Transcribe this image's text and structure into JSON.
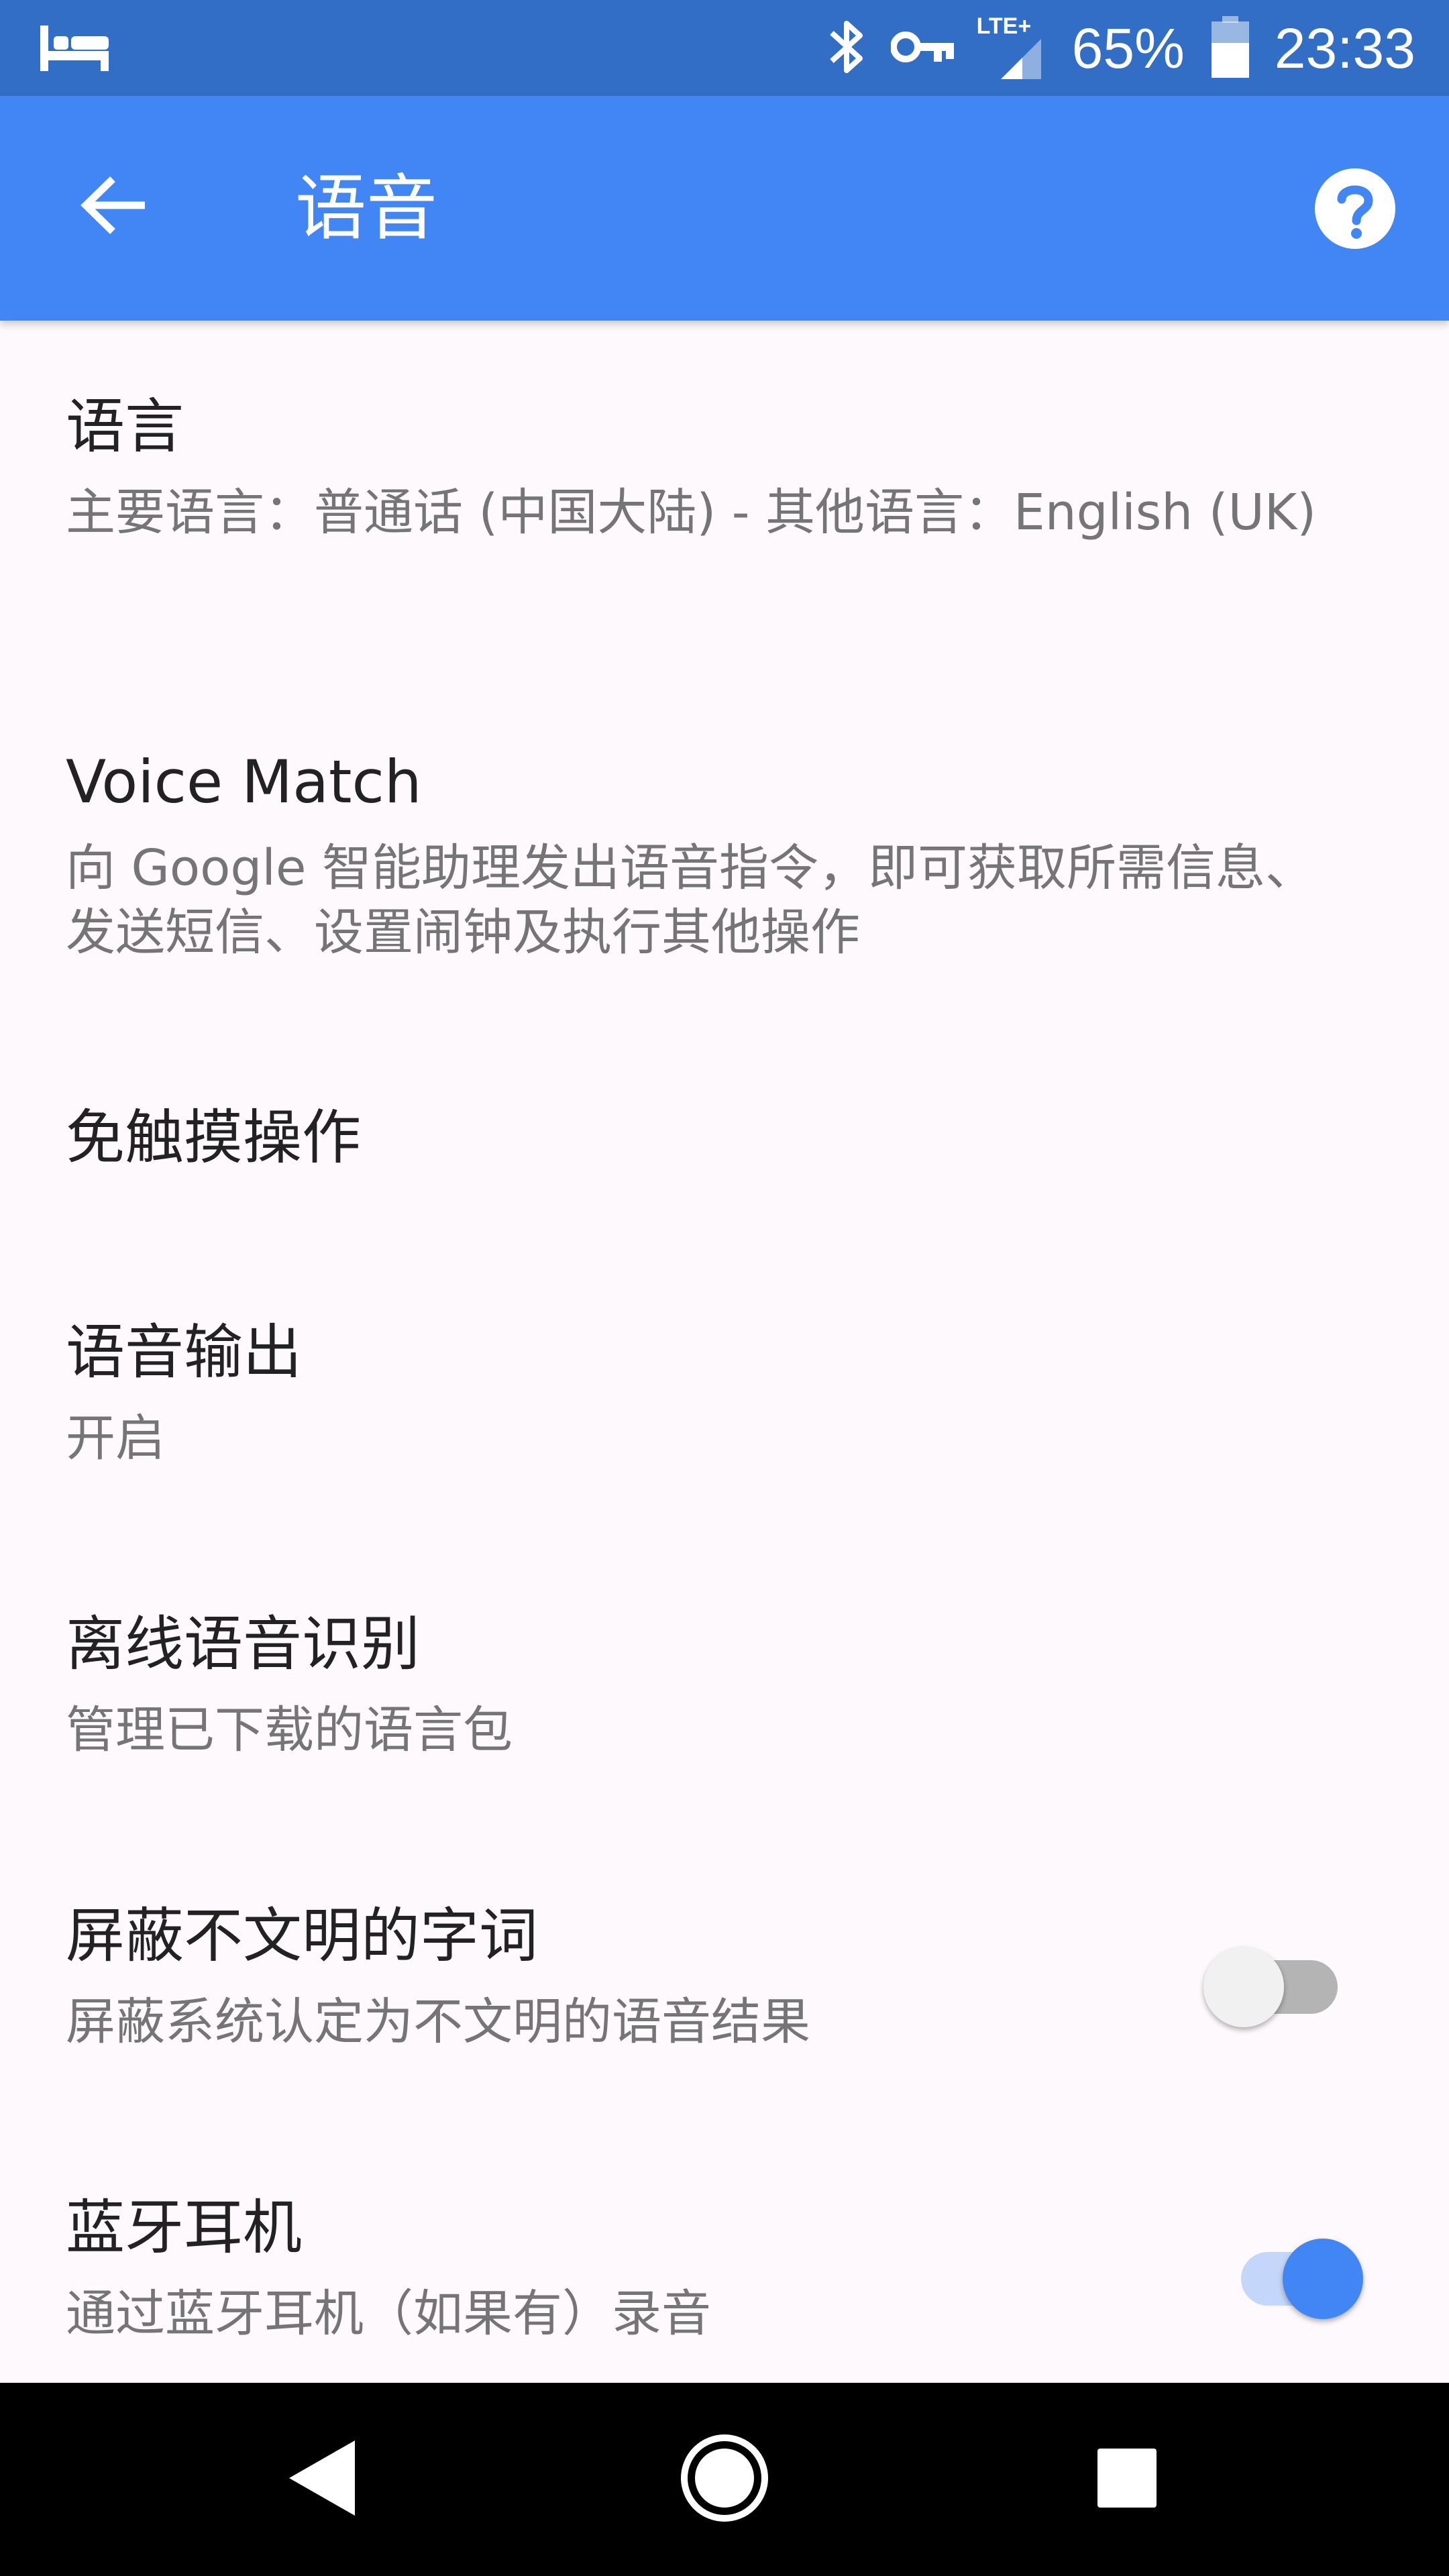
{
  "status_bar": {
    "icons": [
      "sleep-mode-icon",
      "bluetooth-icon",
      "vpn-key-icon",
      "lte-signal-icon",
      "battery-icon"
    ],
    "network": "LTE+",
    "battery": "65%",
    "time": "23:33"
  },
  "app_bar": {
    "title": "语音",
    "back_icon": "arrow-back-icon",
    "help_icon": "help-icon"
  },
  "settings": [
    {
      "title": "语言",
      "summary": "主要语言：普通话 (中国大陆) - 其他语言：English (UK)"
    },
    {
      "title": "Voice Match",
      "summary": "向 Google 智能助理发出语音指令，即可获取所需信息、发送短信、设置闹钟及执行其他操作"
    },
    {
      "title": "免触摸操作"
    },
    {
      "title": "语音输出",
      "summary": "开启"
    },
    {
      "title": "离线语音识别",
      "summary": "管理已下载的语言包"
    },
    {
      "title": "屏蔽不文明的字词",
      "summary": "屏蔽系统认定为不文明的语音结果",
      "switch_on": false
    },
    {
      "title": "蓝牙耳机",
      "summary": "通过蓝牙耳机（如果有）录音",
      "switch_on": true
    }
  ],
  "nav_bar": {
    "icons": [
      "back-triangle-icon",
      "home-circle-icon",
      "recents-square-icon"
    ]
  },
  "colors": {
    "status_bar": "#326ec6",
    "app_bar": "#4285f4",
    "accent": "#4285f4",
    "background": "#fdf9fd"
  }
}
